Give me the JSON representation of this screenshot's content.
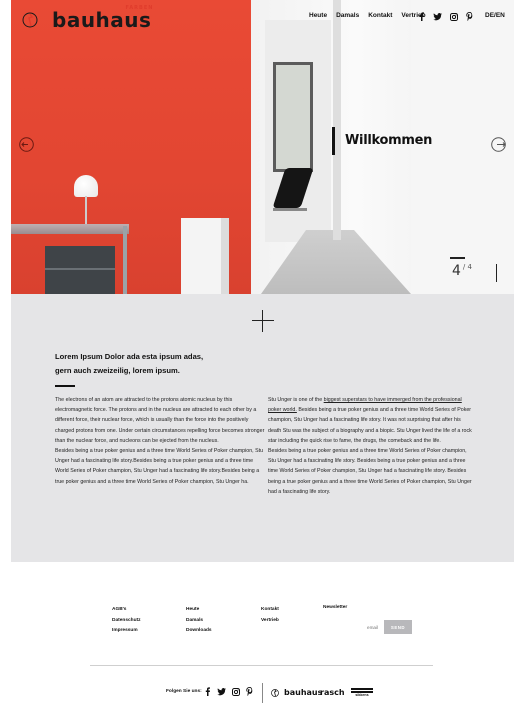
{
  "header": {
    "logo_text": "bauhaus",
    "logo_sub": "FARBEN",
    "nav": [
      "Heute",
      "Damals",
      "Kontakt",
      "Vertrieb"
    ],
    "social_icons": [
      "facebook-icon",
      "twitter-icon",
      "instagram-icon",
      "pinterest-icon"
    ],
    "language": "DE/EN"
  },
  "hero": {
    "title": "Willkommen",
    "counter_current": "4",
    "counter_total": "/ 4",
    "accent_color": "#e94a35"
  },
  "main": {
    "headline_line1": "Lorem Ipsum Dolor ada esta ipsum adas,",
    "headline_line2": "gern auch zweizeilig, lorem ipsum.",
    "col1": "The electrons of an atom are attracted to the protons atomic nucleus by this electromagnetic force. The protons and  in the nucleus are attracted to each other by a different force, their nuclear force, which is usually than the  force into the positively charged protons from one. Under certain circumstances repelling force becomes stronger than the nuclear force, and nucleons can be ejected from the nucleus.",
    "col1_b": "Besides being a true poker genius and a three time World Series of Poker champion, Stu Unger had a fascinating life story.Besides being a true poker genius and a three time World Series of Poker champion, Stu Unger had a fascinating life story.Besides being a true poker genius and a three time World Series of Poker champion, Stu Unger ha.",
    "col2_pre": "Stu Unger is one of the ",
    "col2_link": "biggest superstars to have immerged from the professional poker world.",
    "col2_post": " Besides being a true poker genius and a three time World Series of Poker champion, Stu Unger had a fascinating life story. It was not surprising that after his death Stu was the subject of a biography and a biopic. Stu Unger lived the life of a rock star including the quick rise to fame, the drugs, the comeback and the life.",
    "col2_b": "Besides being a true poker genius and a three time World Series of Poker champion, Stu Unger had a fascinating life story. Besides being a true poker genius and a three time World Series of Poker champion, Stu Unger had a fascinating life story. Besides being a true poker genius and a three time World Series of Poker champion, Stu Unger had a fascinating life story."
  },
  "footer": {
    "col1": [
      "AGB's",
      "Datenschutz",
      "Impressum"
    ],
    "col2": [
      "Heute",
      "Damals",
      "Downloads"
    ],
    "col3": [
      "Kontakt",
      "Vertrieb"
    ],
    "newsletter_label": "Newsletter",
    "email_placeholder": "email",
    "send_label": "SEND",
    "follow_label": "Folgen Sie uns:",
    "brands": [
      "bauhaus",
      "rasch",
      "sikkens"
    ]
  }
}
